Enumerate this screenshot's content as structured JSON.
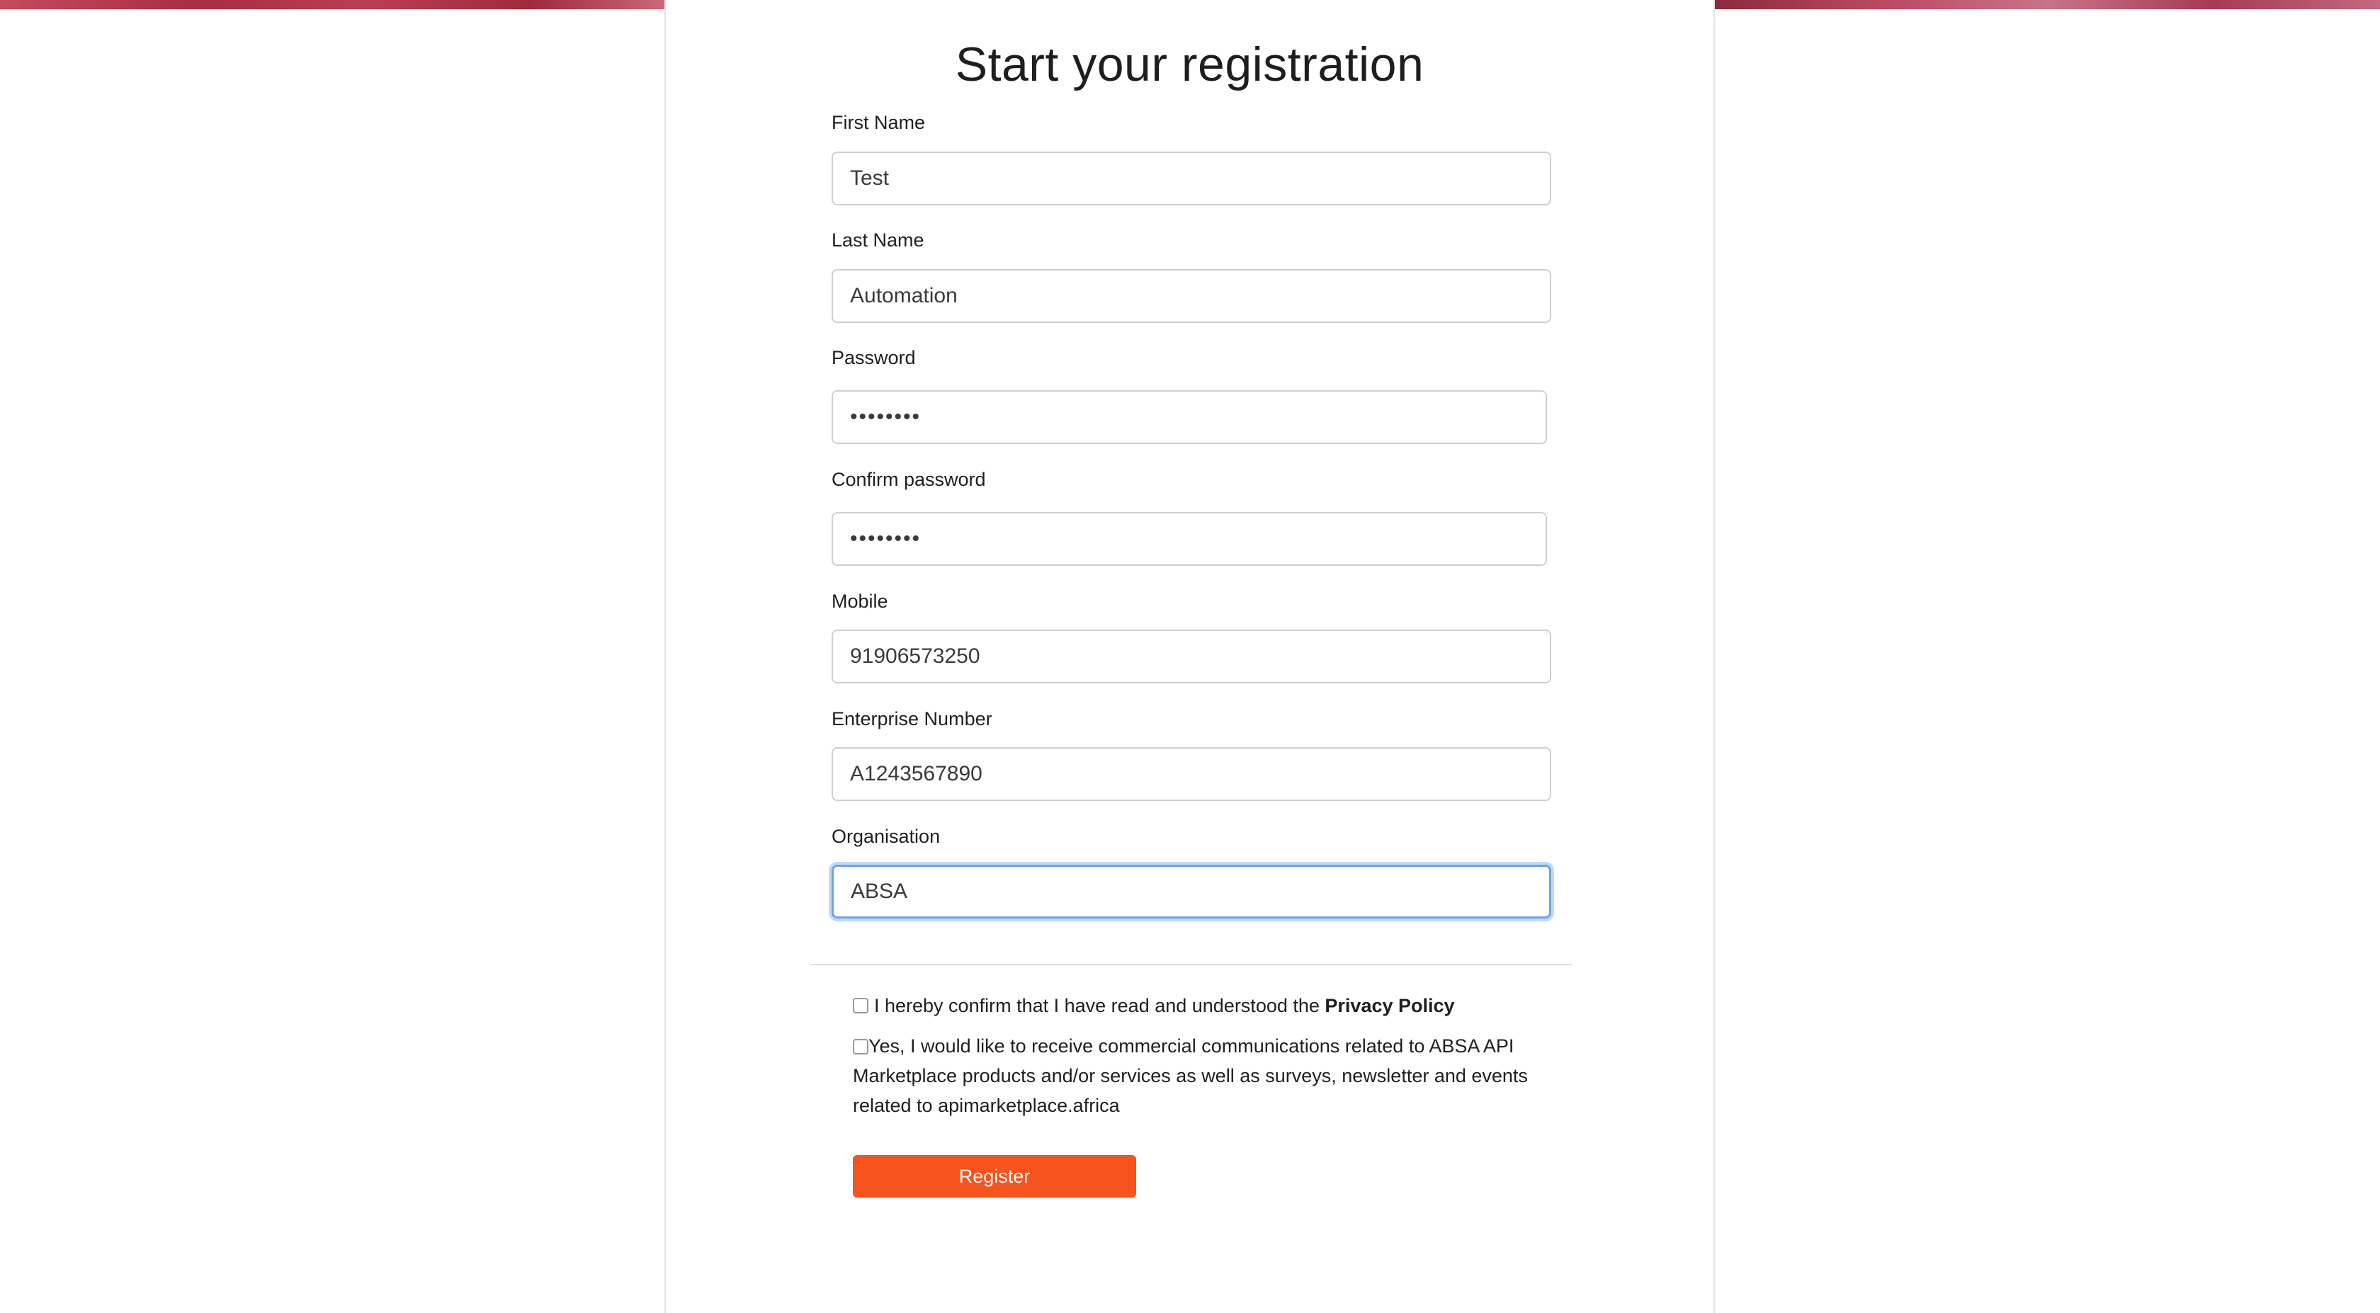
{
  "page": {
    "title": "Start your registration"
  },
  "form": {
    "first_name": {
      "label": "First Name",
      "value": "Test"
    },
    "last_name": {
      "label": "Last Name",
      "value": "Automation"
    },
    "password": {
      "label": "Password",
      "value": "••••••••"
    },
    "confirm_password": {
      "label": "Confirm password",
      "value": "••••••••"
    },
    "mobile": {
      "label": "Mobile",
      "value": "91906573250"
    },
    "enterprise_number": {
      "label": "Enterprise Number",
      "value": "A1243567890"
    },
    "organisation": {
      "label": "Organisation",
      "value": "ABSA"
    }
  },
  "consents": {
    "privacy_prefix": "I hereby confirm that I have read and understood the ",
    "privacy_link": "Privacy Policy",
    "marketing_text": "Yes, I would like to receive commercial communications related to ABSA API Marketplace products and/or services as well as surveys, newsletter and events related to apimarketplace.africa"
  },
  "actions": {
    "register_label": "Register"
  },
  "colors": {
    "accent": "#f7531f",
    "focus": "#6ea4e8"
  }
}
